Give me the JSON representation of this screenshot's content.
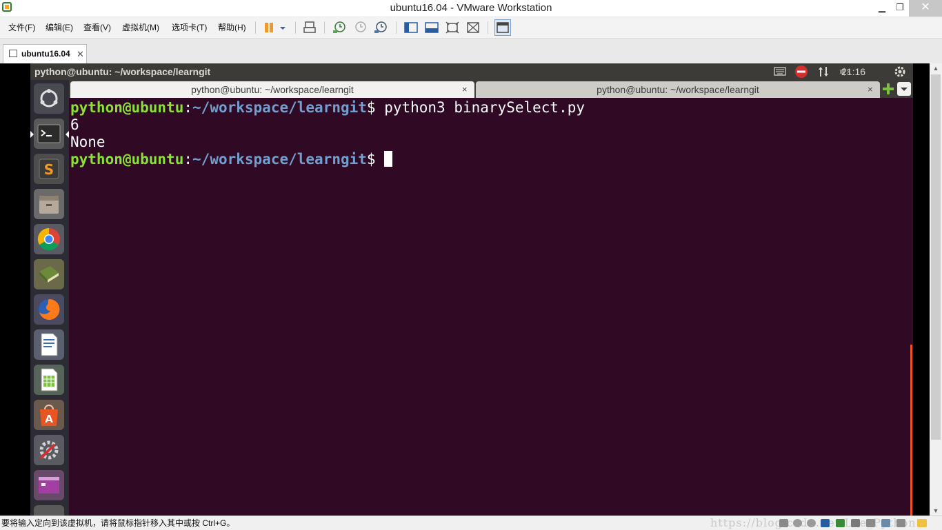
{
  "window": {
    "title": "ubuntu16.04 - VMware Workstation"
  },
  "menubar": {
    "items": [
      "文件(F)",
      "编辑(E)",
      "查看(V)",
      "虚拟机(M)",
      "选项卡(T)",
      "帮助(H)"
    ]
  },
  "vm_tab": {
    "label": "ubuntu16.04",
    "close": "✕"
  },
  "ubuntu_panel": {
    "window_title": "python@ubuntu: ~/workspace/learngit",
    "clock": "21:16"
  },
  "terminal_tabs": [
    {
      "label": "python@ubuntu: ~/workspace/learngit",
      "close": "×",
      "active": true
    },
    {
      "label": "python@ubuntu: ~/workspace/learngit",
      "close": "×",
      "active": false
    }
  ],
  "terminal": {
    "prompt_user": "python@ubuntu",
    "prompt_colon": ":",
    "prompt_path": "~/workspace/learngit",
    "prompt_dollar": "$ ",
    "command": "python3 binarySelect.py",
    "output_1": "6",
    "output_2": "None"
  },
  "statusbar": {
    "text": "要将输入定向到该虚拟机，请将鼠标指针移入其中或按 Ctrl+G。",
    "watermark": "https://blog.csdn.net/Lee_Python"
  },
  "colors": {
    "terminal_bg": "#300a24",
    "prompt_user": "#8ae234",
    "prompt_path": "#729fcf",
    "ubuntu_panel": "#3c3b37",
    "launcher_bg": "#2d2b33",
    "ubuntu_orange": "#e95420"
  }
}
